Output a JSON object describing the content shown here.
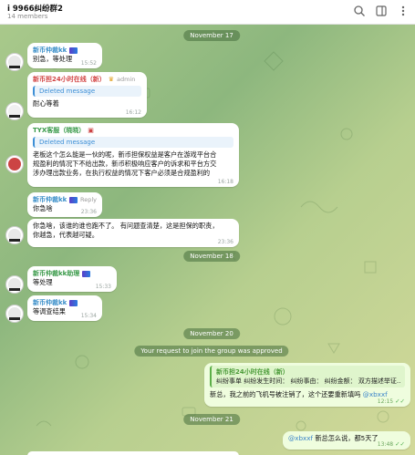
{
  "header": {
    "title": "i 9966纠纷群2",
    "members": "14 members"
  },
  "dates": {
    "d1": "November 17",
    "d2": "November 18",
    "d3": "November 20",
    "d4": "November 21"
  },
  "service": {
    "join_approved": "Your request to join the group was approved"
  },
  "messages": {
    "m1": {
      "name": "新币仲裁kk",
      "text": "别急，等处理",
      "time": "15:52"
    },
    "m2": {
      "name": "新币担24小时在线（新）",
      "role": "admin",
      "quote": "Deleted message",
      "text": "耐心等着",
      "time": "16:12"
    },
    "m3": {
      "name": "TYX客服（晓晓）",
      "quote": "Deleted message",
      "text": "老板这个怎么能是一伙的呢，新币担保权益是客户在游戏平台合规盈利的情况下不给出款，新币积极响应客户的诉求和平台方交涉办理出款业务，在执行权益的情况下客户必须是合规盈利的",
      "time": "16:18"
    },
    "m4": {
      "name": "新币仲裁kk",
      "reply": "Reply",
      "text": "你急啥",
      "time": "23:36"
    },
    "m5": {
      "text": "你急啥，该谁的谁也跑不了。 有问题查清楚，这是担保的职责，你越急，代表越可疑。",
      "time": "23:36"
    },
    "m6": {
      "name": "新币仲裁kk助理",
      "text": "等处理",
      "time": "15:33"
    },
    "m7": {
      "name": "新币仲裁kk",
      "text": "等调查结果",
      "time": "15:34"
    },
    "m8": {
      "name": "新币担24小时在线（新）",
      "line1": "纠纷事单 纠纷发生时间：  纠纷事由：  纠纷金额：  双方描述举证...",
      "text": "新总，我之前的飞机号被注销了，这个还要重新填吗",
      "mention": "@xbxxf",
      "time": "12:15"
    },
    "m9": {
      "mention": "@xbxxf",
      "text": "新总怎么说，都5天了",
      "time": "13:48"
    }
  },
  "colors": {
    "accent": "#3d8fd6",
    "name_blue": "#3b8fc9",
    "name_red": "#d24545",
    "name_green": "#3a9a4a",
    "out_bubble": "#effdde"
  }
}
